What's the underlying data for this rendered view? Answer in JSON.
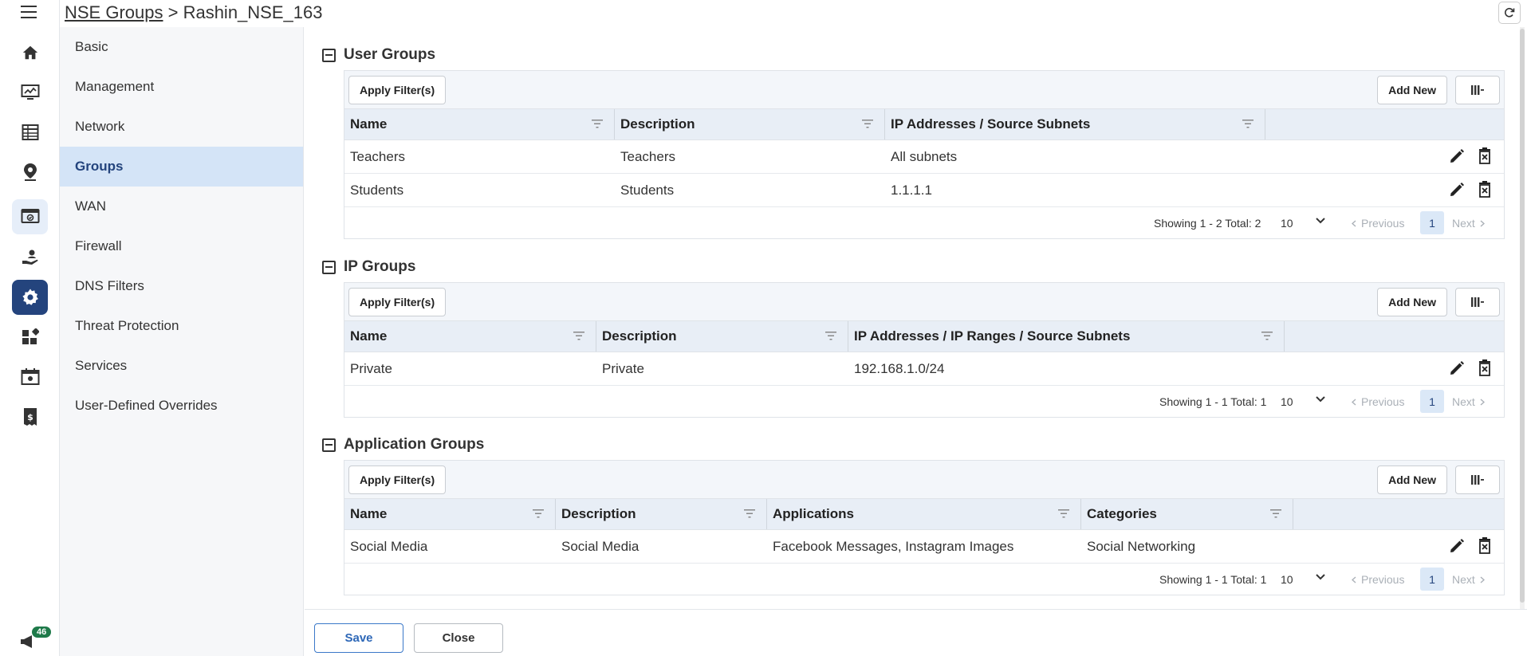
{
  "header": {
    "breadcrumb_link": "NSE Groups",
    "breadcrumb_sep": " > ",
    "breadcrumb_current": "Rashin_NSE_163"
  },
  "rail": {
    "icons": [
      "home-icon",
      "monitor-chart-icon",
      "table-icon",
      "location-pin-icon",
      "screen-check-icon",
      "hand-user-icon",
      "gear-icon",
      "widgets-icon",
      "calendar-screen-icon",
      "billing-icon"
    ],
    "promo_badge": "46",
    "colors": {
      "active_bg": "#24447d",
      "soft_bg": "#e6eef9"
    }
  },
  "subnav": {
    "items": [
      "Basic",
      "Management",
      "Network",
      "Groups",
      "WAN",
      "Firewall",
      "DNS Filters",
      "Threat Protection",
      "Services",
      "User-Defined Overrides"
    ],
    "active": "Groups"
  },
  "toolbar": {
    "apply_filters": "Apply Filter(s)",
    "add_new": "Add New"
  },
  "user_groups": {
    "title": "User Groups",
    "columns": [
      "Name",
      "Description",
      "IP Addresses / Source Subnets"
    ],
    "rows": [
      [
        "Teachers",
        "Teachers",
        "All subnets"
      ],
      [
        "Students",
        "Students",
        "1.1.1.1"
      ]
    ],
    "showing": "Showing 1 - 2 Total: 2",
    "page_size": "10",
    "prev": "Previous",
    "page": "1",
    "next": "Next"
  },
  "ip_groups": {
    "title": "IP Groups",
    "columns": [
      "Name",
      "Description",
      "IP Addresses / IP Ranges / Source Subnets"
    ],
    "rows": [
      [
        "Private",
        "Private",
        "192.168.1.0/24"
      ]
    ],
    "showing": "Showing 1 - 1 Total: 1",
    "page_size": "10",
    "prev": "Previous",
    "page": "1",
    "next": "Next"
  },
  "application_groups": {
    "title": "Application Groups",
    "columns": [
      "Name",
      "Description",
      "Applications",
      "Categories"
    ],
    "rows": [
      [
        "Social Media",
        "Social Media",
        "Facebook Messages, Instagram Images",
        "Social Networking"
      ]
    ],
    "showing": "Showing 1 - 1 Total: 1",
    "page_size": "10",
    "prev": "Previous",
    "page": "1",
    "next": "Next"
  },
  "footer_buttons": {
    "save": "Save",
    "close": "Close"
  },
  "colors": {
    "brand": "#24447d",
    "link_blue": "#2d67b7",
    "header_row_bg": "#e8eef6",
    "toolbar_bg": "#f3f6fa"
  }
}
